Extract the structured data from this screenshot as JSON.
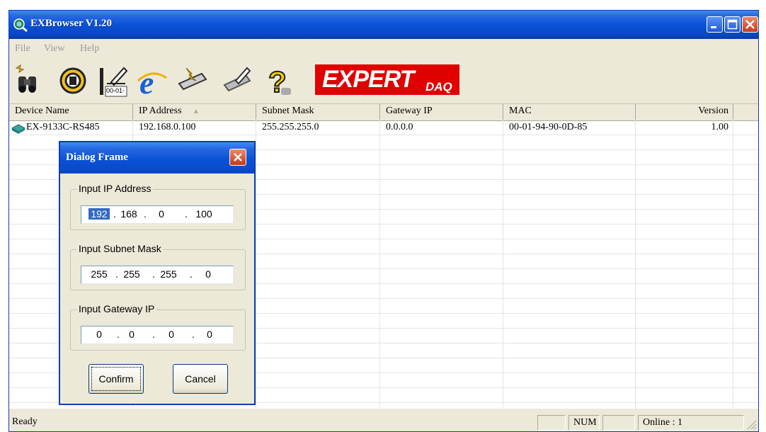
{
  "window": {
    "title": "EXBrowser V1.20"
  },
  "menu": [
    "File",
    "View",
    "Help"
  ],
  "toolbar": {
    "logo_main": "EXPERT",
    "logo_sub": "DAQ",
    "tool_label_3": "00-01-"
  },
  "columns": [
    "Device Name",
    "IP Address",
    "Subnet Mask",
    "Gateway IP",
    "MAC",
    "Version"
  ],
  "rows": [
    {
      "device_name": "EX-9133C-RS485",
      "ip": "192.168.0.100",
      "subnet": "255.255.255.0",
      "gateway": "0.0.0.0",
      "mac": "00-01-94-90-0D-85",
      "version": "1.00"
    }
  ],
  "dialog": {
    "title": "Dialog Frame",
    "ip_label": "Input IP Address",
    "ip": [
      "192",
      "168",
      "0",
      "100"
    ],
    "subnet_label": "Input Subnet Mask",
    "subnet": [
      "255",
      "255",
      "255",
      "0"
    ],
    "gateway_label": "Input Gateway IP",
    "gateway": [
      "0",
      "0",
      "0",
      "0"
    ],
    "confirm": "Confirm",
    "cancel": "Cancel"
  },
  "status": {
    "text": "Ready",
    "num": "NUM",
    "online": "Online : 1"
  },
  "colors": {
    "title_bar": "#0a52d6",
    "logo_red": "#e00000",
    "selection": "#316ac5"
  }
}
